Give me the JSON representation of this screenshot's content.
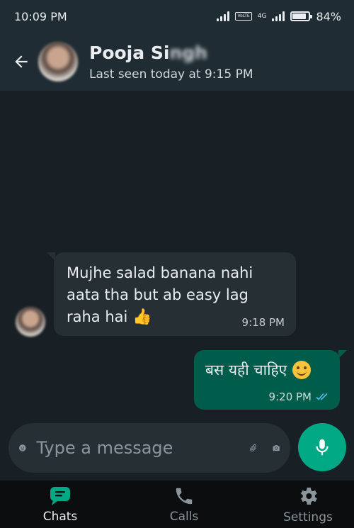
{
  "status_bar": {
    "time": "10:09 PM",
    "lte_label": "VoLTE",
    "network_label": "4G",
    "battery_percent": 84,
    "battery_text": "84%"
  },
  "header": {
    "contact_name_visible": "Pooja Si",
    "contact_name_blurred": "ngh",
    "last_seen": "Last seen today at 9:15 PM"
  },
  "messages": [
    {
      "direction": "incoming",
      "text": "Mujhe salad banana nahi aata tha but ab easy lag raha hai",
      "emoji": "👍",
      "time": "9:18 PM"
    },
    {
      "direction": "outgoing",
      "text": "बस यही चाहिए",
      "emoji": "smiling-face",
      "time": "9:20 PM",
      "read_receipt": "double-check-blue"
    }
  ],
  "input": {
    "placeholder": "Type a message"
  },
  "bottom_nav": {
    "items": [
      {
        "label": "Chats",
        "icon": "chat-icon",
        "active": true
      },
      {
        "label": "Calls",
        "icon": "phone-icon",
        "active": false
      },
      {
        "label": "Settings",
        "icon": "gear-icon",
        "active": false
      }
    ]
  },
  "colors": {
    "accent": "#00a884",
    "outgoing_bubble": "#005c4b",
    "incoming_bubble": "#262f34",
    "read_tick": "#53bdeb"
  }
}
